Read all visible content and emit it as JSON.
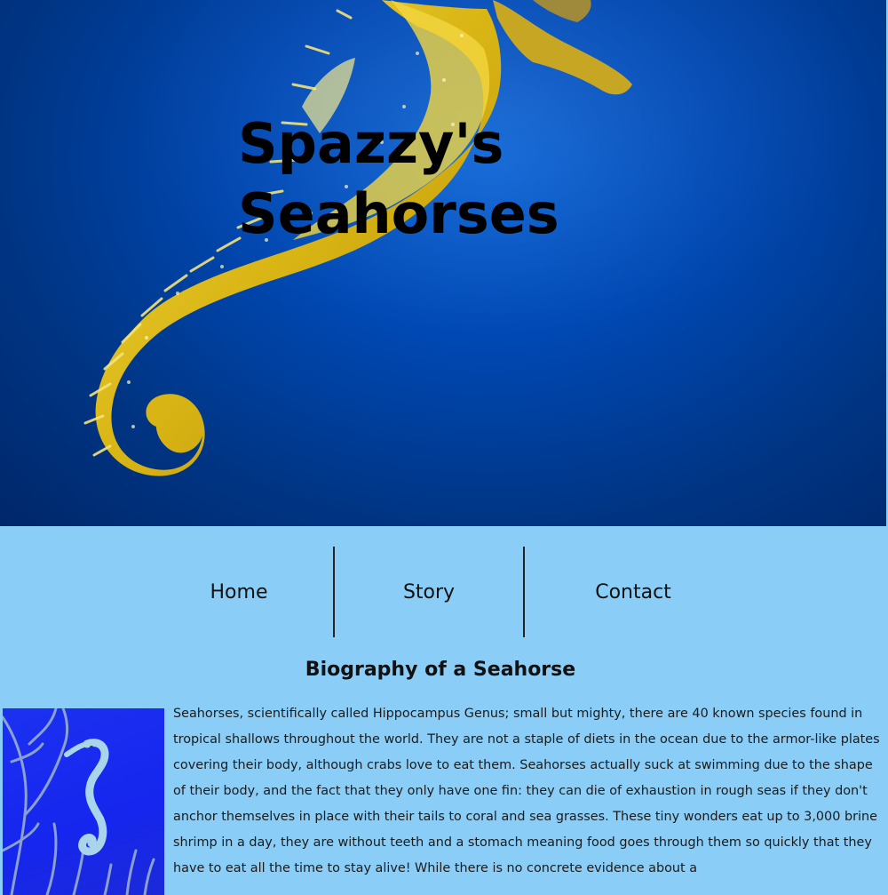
{
  "site": {
    "title_line1": "Spazzy's",
    "title_line2": "Seahorses"
  },
  "nav": {
    "items": [
      {
        "label": "Home"
      },
      {
        "label": "Story"
      },
      {
        "label": "Contact"
      }
    ]
  },
  "section": {
    "heading": "Biography of a Seahorse",
    "paragraph": "Seahorses, scientifically called Hippocampus Genus; small but mighty, there are 40 known species found in tropical shallows throughout the world. They are not a staple of diets in the ocean due to the armor-like plates covering their body, although crabs love to eat them. Seahorses actually suck at swimming due to the shape of their body, and the fact that they only have one fin: they can die of exhaustion in rough seas if they don't anchor themselves in place with their tails to coral and sea grasses. These tiny wonders eat up to 3,000 brine shrimp in a day, they are without teeth and a stomach meaning food goes through them so quickly that they have to eat all the time to stay alive! While there is no concrete evidence about a"
  },
  "colors": {
    "page_background": "#8acdf7",
    "hero_water": "#0048b3",
    "seahorse_yellow": "#e8c21a"
  }
}
